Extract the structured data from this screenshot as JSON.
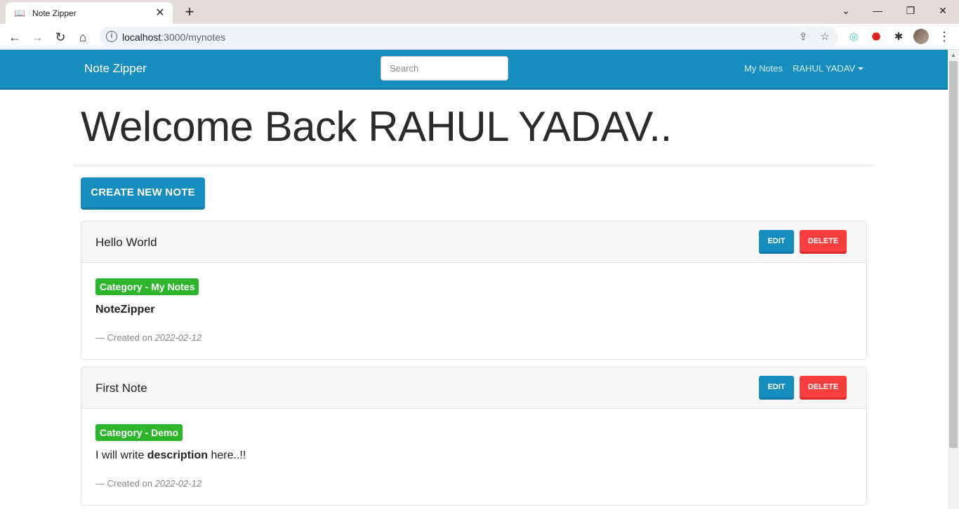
{
  "browser": {
    "tab_title": "Note Zipper",
    "tab_close": "✕",
    "new_tab": "+",
    "url_host": "localhost",
    "url_rest": ":3000/mynotes"
  },
  "navbar": {
    "brand": "Note Zipper",
    "search_placeholder": "Search",
    "my_notes": "My Notes",
    "user": "RAHUL YADAV"
  },
  "main": {
    "welcome": "Welcome Back RAHUL YADAV..",
    "create_button": "CREATE NEW NOTE",
    "edit_label": "EDIT",
    "delete_label": "DELETE",
    "created_prefix": "— Created on",
    "notes": [
      {
        "title": "Hello World",
        "category": "Category - My Notes",
        "content_bold": "NoteZipper",
        "content_pre": "",
        "content_post": "",
        "created": "2022-02-12"
      },
      {
        "title": "First Note",
        "category": "Category - Demo",
        "content_pre": "I will write ",
        "content_bold": "description",
        "content_post": " here..!!",
        "created": "2022-02-12"
      }
    ]
  },
  "colors": {
    "primary": "#178dbd",
    "danger": "#f63e3e",
    "success": "#2db52d"
  }
}
